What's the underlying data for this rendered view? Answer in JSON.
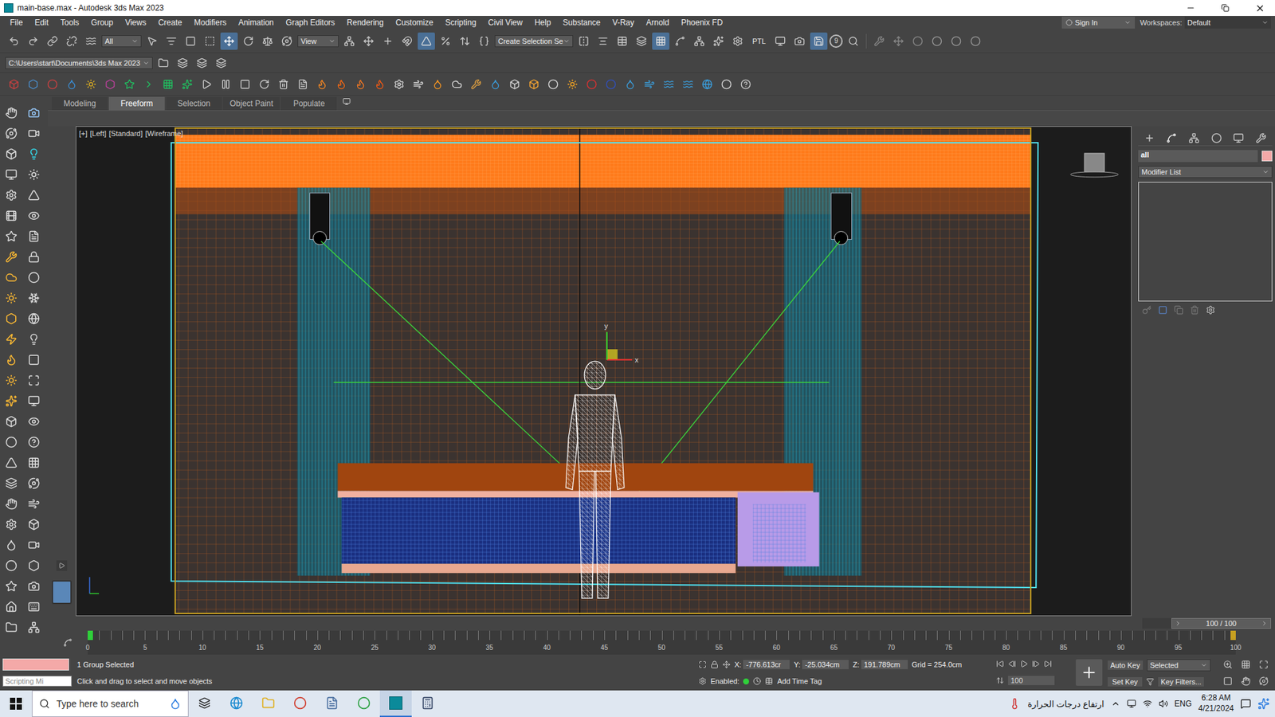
{
  "window": {
    "title": "main-base.max - Autodesk 3ds Max 2023"
  },
  "menu": [
    "File",
    "Edit",
    "Tools",
    "Group",
    "Views",
    "Create",
    "Modifiers",
    "Animation",
    "Graph Editors",
    "Rendering",
    "Customize",
    "Scripting",
    "Civil View",
    "Help",
    "Substance",
    "V-Ray",
    "Arnold",
    "Phoenix FD"
  ],
  "account": {
    "sign_in": "Sign In",
    "workspaces_label": "Workspaces:",
    "workspace": "Default"
  },
  "main_toolbar": {
    "selection_filter": "All",
    "reference_coordinate": "View",
    "named_selection": "Create Selection Se",
    "ptl": "PTL",
    "counter": "9"
  },
  "project_path": "C:\\Users\\start\\Documents\\3ds Max 2023",
  "ribbon_tabs": [
    {
      "label": "Modeling",
      "selected": false
    },
    {
      "label": "Freeform",
      "selected": true
    },
    {
      "label": "Selection",
      "selected": false
    },
    {
      "label": "Object Paint",
      "selected": false
    },
    {
      "label": "Populate",
      "selected": false
    }
  ],
  "viewport": {
    "labels": [
      "[+]",
      "[Left]",
      "[Standard]",
      "[Wireframe]"
    ],
    "gizmo_axes": [
      "x",
      "y"
    ]
  },
  "command_panel": {
    "object_name": "all",
    "modifier_list": "Modifier List"
  },
  "time_slider": {
    "position": "100 / 100",
    "level": 1
  },
  "track_ticks": [
    "0",
    "5",
    "10",
    "15",
    "20",
    "25",
    "30",
    "35",
    "40",
    "45",
    "50",
    "55",
    "60",
    "65",
    "70",
    "75",
    "80",
    "85",
    "90",
    "95",
    "100"
  ],
  "status": {
    "selection": "1 Group Selected",
    "prompt": "Click and drag to select and move objects",
    "script_listener": "Scripting Mi",
    "coords": [
      {
        "axis": "X:",
        "value": "-776.613cr"
      },
      {
        "axis": "Y:",
        "value": "-25.034cm"
      },
      {
        "axis": "Z:",
        "value": "191.789cm"
      }
    ],
    "grid": "Grid = 254.0cm",
    "enabled_label": "Enabled:",
    "enabled": true,
    "add_time_tag": "Add Time Tag",
    "auto_key": "Auto Key",
    "auto_key_on": false,
    "key_mode": "Selected",
    "set_key": "Set Key",
    "key_filters": "Key Filters...",
    "frame": "100"
  },
  "taskbar": {
    "search_placeholder": "Type here to search",
    "weather": "ارتفاع درجات الحرارة",
    "language": "ENG",
    "time": "6:28 AM",
    "date": "4/21/2024"
  }
}
